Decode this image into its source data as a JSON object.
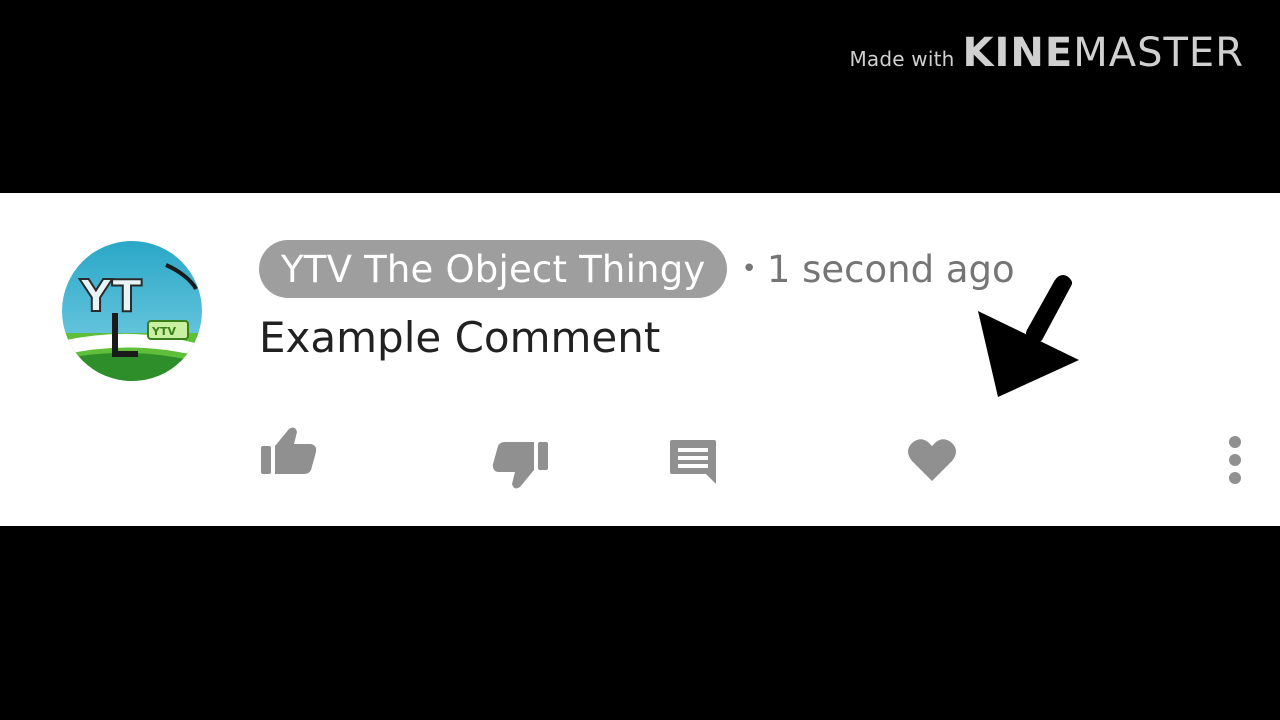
{
  "watermark": {
    "made_with": "Made with",
    "brand_bold": "KINE",
    "brand_regular": "MASTER"
  },
  "comment": {
    "author": "YTV The Object Thingy",
    "separator": "•",
    "timestamp": "1 second ago",
    "text": "Example Comment"
  },
  "actions": {
    "like_icon": "thumbs-up-icon",
    "dislike_icon": "thumbs-down-icon",
    "reply_icon": "reply-comment-icon",
    "heart_icon": "heart-icon",
    "more_icon": "more-vertical-icon"
  },
  "colors": {
    "letterbox": "#000000",
    "strip_background": "#ffffff",
    "author_chip": "#9e9e9e",
    "icon_gray": "#909090",
    "meta_text": "#757575",
    "comment_text": "#212121",
    "watermark_text": "#d0d0d0"
  }
}
